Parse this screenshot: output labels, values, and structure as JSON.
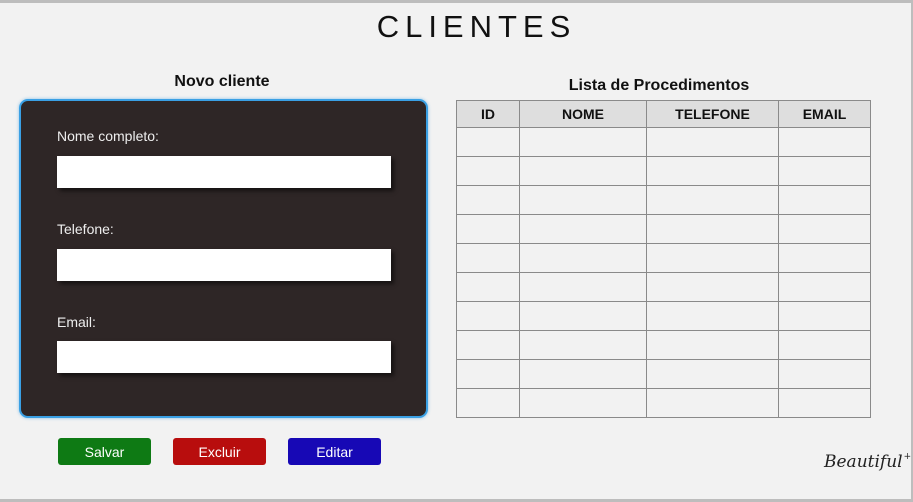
{
  "header": {
    "title": "CLIENTES"
  },
  "form": {
    "heading": "Novo cliente",
    "fields": [
      {
        "label": "Nome completo:",
        "value": "",
        "placeholder": ""
      },
      {
        "label": "Telefone:",
        "value": "",
        "placeholder": ""
      },
      {
        "label": "Email:",
        "value": "",
        "placeholder": ""
      }
    ]
  },
  "buttons": {
    "save": "Salvar",
    "delete": "Excluir",
    "edit": "Editar"
  },
  "table": {
    "heading": "Lista de Procedimentos",
    "columns": [
      "ID",
      "NOME",
      "TELEFONE",
      "EMAIL"
    ],
    "rows": [
      [
        "",
        "",
        "",
        ""
      ],
      [
        "",
        "",
        "",
        ""
      ],
      [
        "",
        "",
        "",
        ""
      ],
      [
        "",
        "",
        "",
        ""
      ],
      [
        "",
        "",
        "",
        ""
      ],
      [
        "",
        "",
        "",
        ""
      ],
      [
        "",
        "",
        "",
        ""
      ],
      [
        "",
        "",
        "",
        ""
      ],
      [
        "",
        "",
        "",
        ""
      ],
      [
        "",
        "",
        "",
        ""
      ]
    ]
  },
  "brand": {
    "text": "Beautiful",
    "sparkle": "+"
  },
  "colors": {
    "card_bg": "#2e2626",
    "card_border": "#3aa0e4",
    "save": "#0e7a14",
    "delete": "#b80d0d",
    "edit": "#1708b5"
  }
}
